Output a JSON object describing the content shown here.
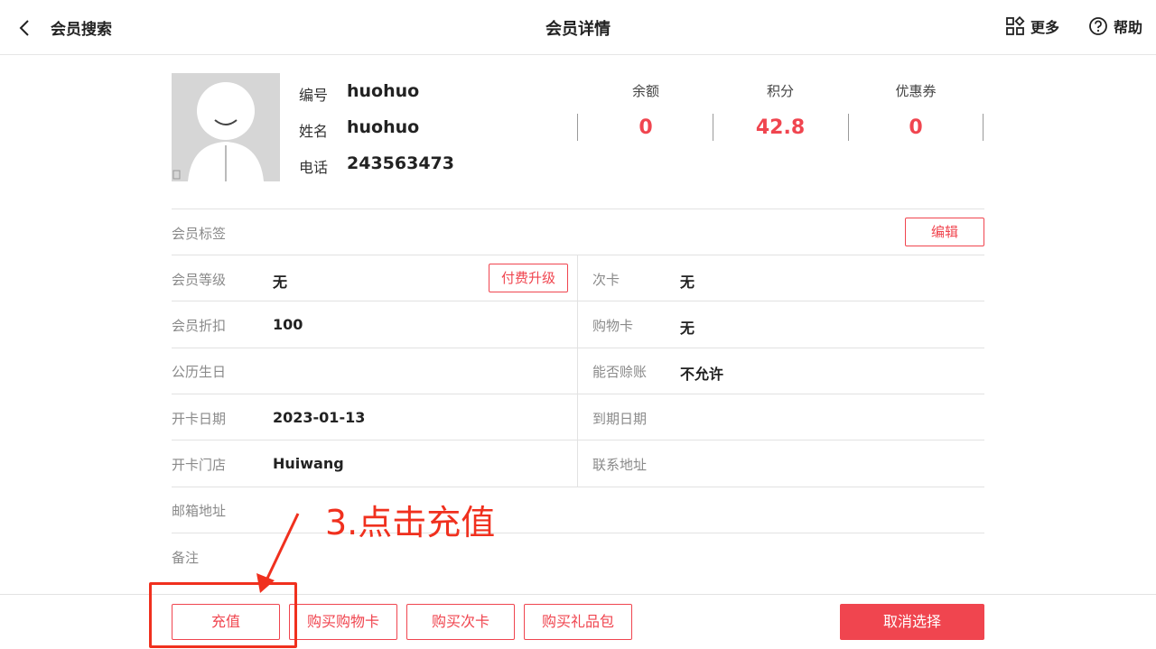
{
  "header": {
    "back_label": "会员搜索",
    "title": "会员详情",
    "more_label": "更多",
    "help_label": "帮助"
  },
  "member": {
    "id_label": "编号",
    "id_value": "huohuo",
    "name_label": "姓名",
    "name_value": "huohuo",
    "phone_label": "电话",
    "phone_value": "243563473"
  },
  "stats": [
    {
      "label": "余额",
      "value": "0"
    },
    {
      "label": "积分",
      "value": "42.8"
    },
    {
      "label": "优惠券",
      "value": "0"
    }
  ],
  "fields": {
    "tags_label": "会员标签",
    "edit_button": "编辑",
    "level_label": "会员等级",
    "level_value": "无",
    "upgrade_button": "付费升级",
    "times_card_label": "次卡",
    "times_card_value": "无",
    "discount_label": "会员折扣",
    "discount_value": "100",
    "shopping_card_label": "购物卡",
    "shopping_card_value": "无",
    "birthday_label": "公历生日",
    "credit_label": "能否赊账",
    "credit_value": "不允许",
    "open_date_label": "开卡日期",
    "open_date_value": "2023-01-13",
    "expire_label": "到期日期",
    "store_label": "开卡门店",
    "store_value": "Huiwang",
    "address_label": "联系地址",
    "email_label": "邮箱地址",
    "remark_label": "备注"
  },
  "actions": {
    "recharge": "充值",
    "buy_shopping_card": "购买购物卡",
    "buy_times_card": "购买次卡",
    "buy_gift_pack": "购买礼品包",
    "cancel_selection": "取消选择"
  },
  "annotation": {
    "text": "3.点击充值"
  },
  "colors": {
    "accent": "#f0454f",
    "annotation": "#f0301e"
  }
}
